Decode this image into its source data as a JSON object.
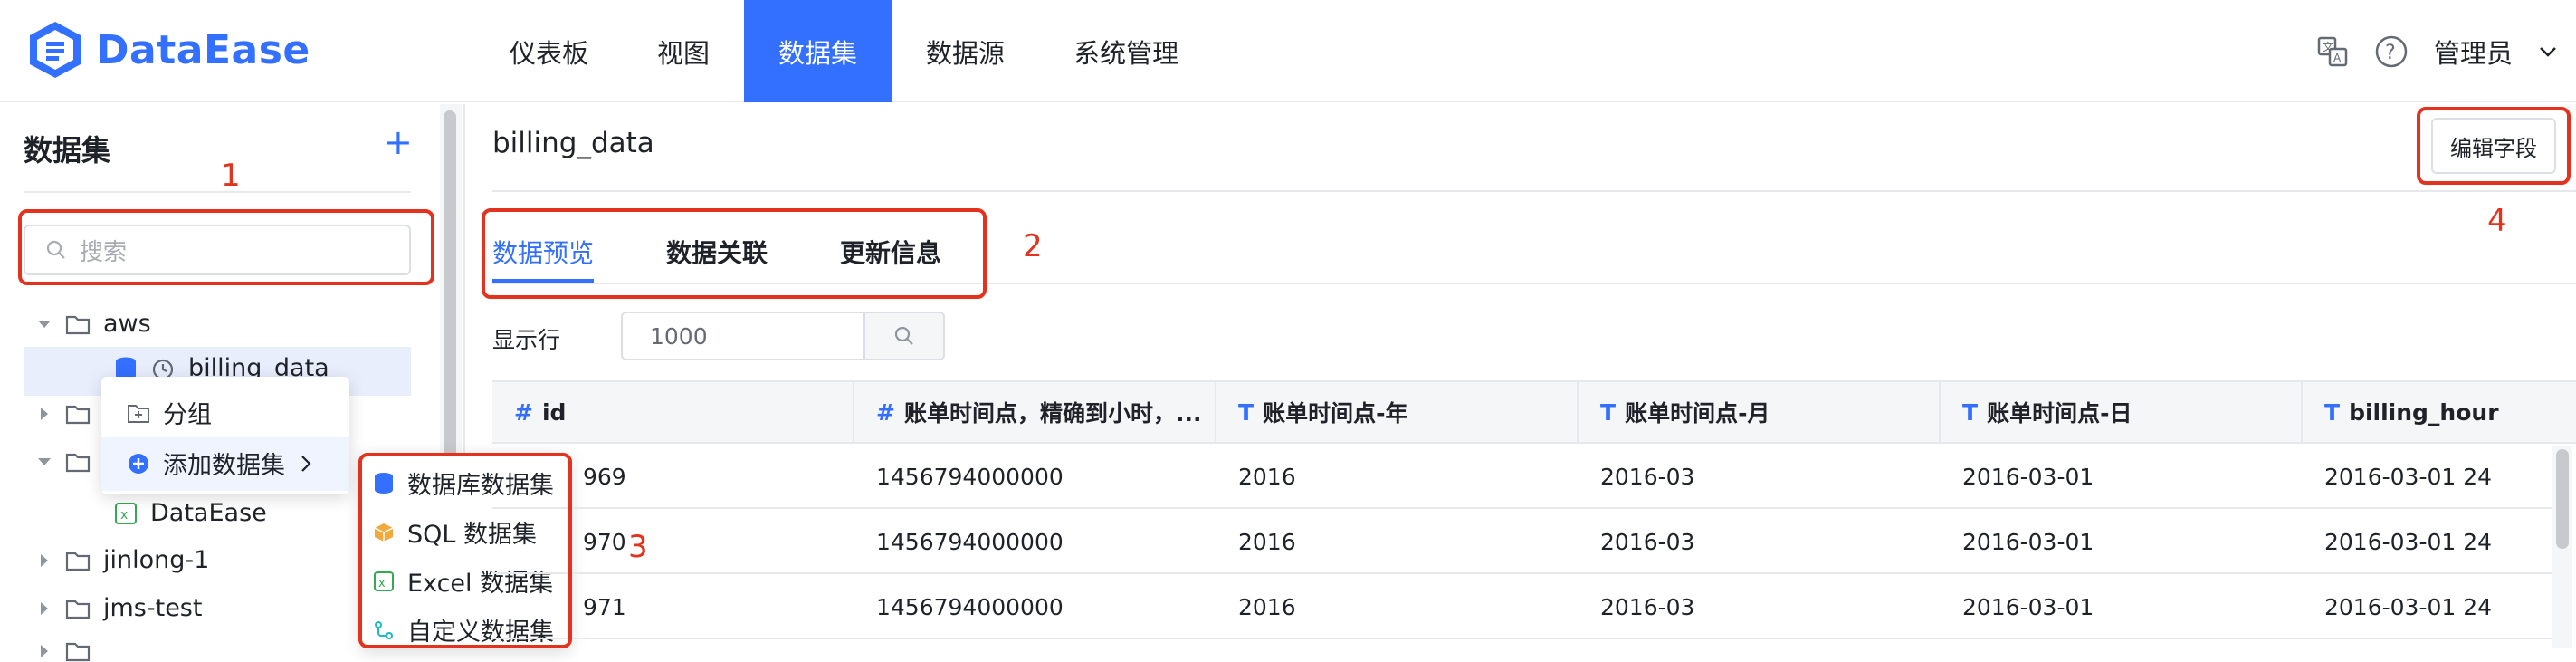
{
  "app": {
    "name": "DataEase"
  },
  "nav": {
    "items": [
      "仪表板",
      "视图",
      "数据集",
      "数据源",
      "系统管理"
    ],
    "active": 2
  },
  "header": {
    "user": "管理员",
    "translate_icon": "translate-icon",
    "help_icon": "help-icon"
  },
  "sidebar": {
    "title": "数据集",
    "search_placeholder": "搜索",
    "tree": [
      {
        "label": "aws",
        "type": "folder",
        "expanded": true
      },
      {
        "label": "billing_data",
        "type": "dataset"
      },
      {
        "label": "DataEase",
        "type": "excel-dataset"
      },
      {
        "label": "jinlong-1",
        "type": "folder"
      },
      {
        "label": "jms-test",
        "type": "folder"
      }
    ]
  },
  "context_menu": {
    "items": [
      "分组",
      "添加数据集"
    ]
  },
  "submenu": {
    "items": [
      "数据库数据集",
      "SQL 数据集",
      "Excel 数据集",
      "自定义数据集"
    ]
  },
  "main": {
    "title": "billing_data",
    "edit_button": "编辑字段",
    "tabs": [
      "数据预览",
      "数据关联",
      "更新信息"
    ],
    "active_tab": 0,
    "rows_label": "显示行",
    "rows_value": "1000"
  },
  "table": {
    "columns": [
      {
        "type": "#",
        "name": "id"
      },
      {
        "type": "#",
        "name": "账单时间点，精确到小时，..."
      },
      {
        "type": "T",
        "name": "账单时间点-年"
      },
      {
        "type": "T",
        "name": "账单时间点-月"
      },
      {
        "type": "T",
        "name": "账单时间点-日"
      },
      {
        "type": "T",
        "name": "billing_hour"
      }
    ],
    "rows": [
      [
        "969",
        "1456794000000",
        "2016",
        "2016-03",
        "2016-03-01",
        "2016-03-01 24"
      ],
      [
        "970",
        "1456794000000",
        "2016",
        "2016-03",
        "2016-03-01",
        "2016-03-01 24"
      ],
      [
        "971",
        "1456794000000",
        "2016",
        "2016-03",
        "2016-03-01",
        "2016-03-01 24"
      ]
    ]
  },
  "annotations": [
    "1",
    "2",
    "3",
    "4"
  ],
  "colors": {
    "accent": "#3370ff",
    "annotation": "#e3321d"
  }
}
